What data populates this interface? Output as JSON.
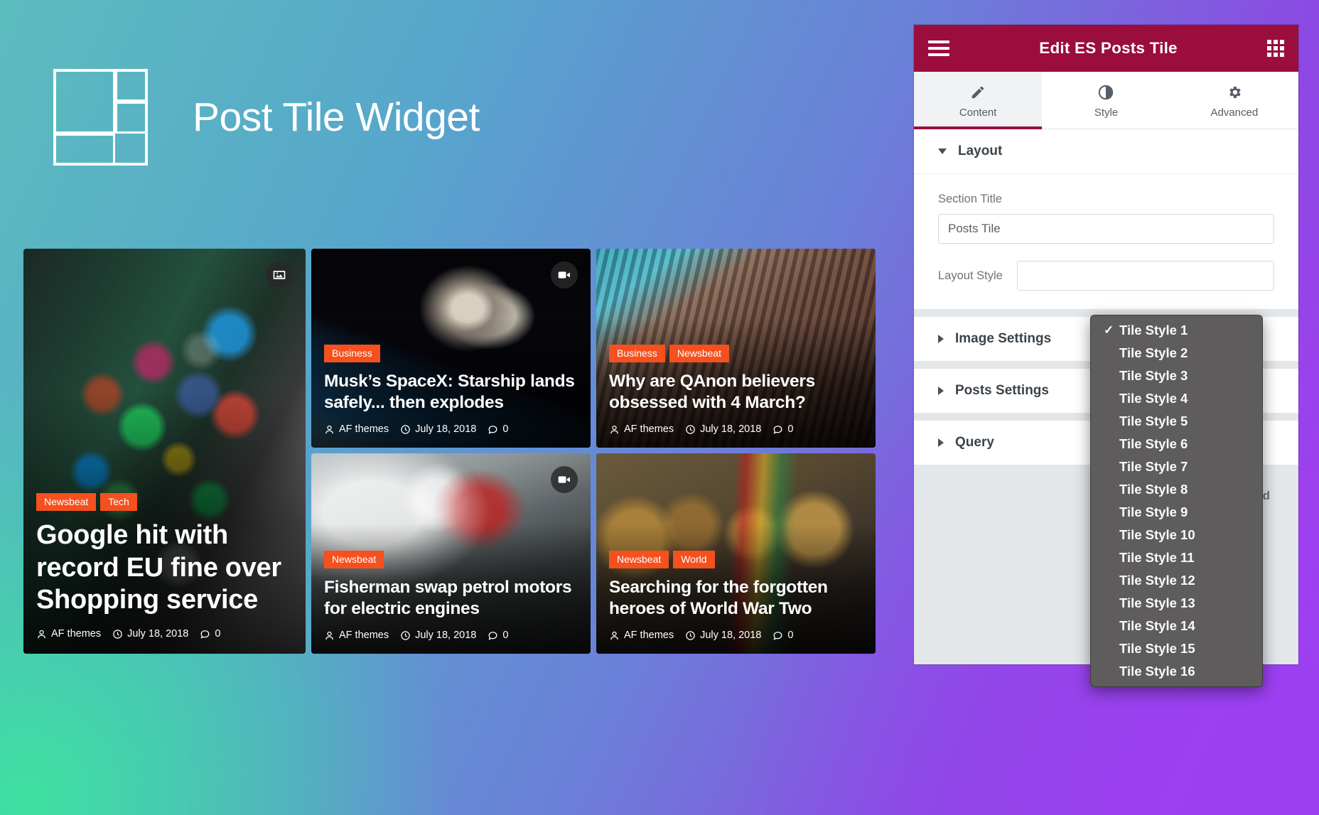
{
  "hero": {
    "title": "Post Tile Widget",
    "logo_icon": "tile-grid-logo"
  },
  "tiles": [
    {
      "categories": [
        "Newsbeat",
        "Tech"
      ],
      "title": "Google hit with record EU fine over Shopping service",
      "author": "AF themes",
      "date": "July 18, 2018",
      "comments": "0",
      "media_icon": "image-icon",
      "size": "big"
    },
    {
      "categories": [
        "Business"
      ],
      "title": "Musk’s SpaceX: Starship lands safely... then explodes",
      "author": "AF themes",
      "date": "July 18, 2018",
      "comments": "0",
      "media_icon": "video-icon",
      "size": "small"
    },
    {
      "categories": [
        "Business",
        "Newsbeat"
      ],
      "title": "Why are QAnon believers obsessed with 4 March?",
      "author": "AF themes",
      "date": "July 18, 2018",
      "comments": "0",
      "media_icon": "none",
      "size": "small"
    },
    {
      "categories": [
        "Newsbeat"
      ],
      "title": "Fisherman swap petrol motors for electric engines",
      "author": "AF themes",
      "date": "July 18, 2018",
      "comments": "0",
      "media_icon": "video-icon",
      "size": "small"
    },
    {
      "categories": [
        "Newsbeat",
        "World"
      ],
      "title": "Searching for the forgotten heroes of World War Two",
      "author": "AF themes",
      "date": "July 18, 2018",
      "comments": "0",
      "media_icon": "none",
      "size": "small"
    }
  ],
  "panel": {
    "header": {
      "title": "Edit ES Posts Tile",
      "menu_icon": "hamburger-icon",
      "apps_icon": "grid-apps-icon"
    },
    "tabs": [
      {
        "label": "Content",
        "icon": "pencil-icon",
        "active": true
      },
      {
        "label": "Style",
        "icon": "contrast-icon",
        "active": false
      },
      {
        "label": "Advanced",
        "icon": "gear-icon",
        "active": false
      }
    ],
    "sections": [
      {
        "title": "Layout",
        "expanded": true
      },
      {
        "title": "Image Settings",
        "expanded": false
      },
      {
        "title": "Posts Settings",
        "expanded": false
      },
      {
        "title": "Query",
        "expanded": false
      }
    ],
    "fields": {
      "section_title_label": "Section Title",
      "section_title_value": "Posts Tile",
      "section_title_placeholder": "Posts Tile",
      "layout_style_label": "Layout Style"
    },
    "footer": {
      "need_help": "Need"
    },
    "colors": {
      "header_bg": "#9b0d3c",
      "accent": "#9b0d3c",
      "panel_bg": "#e3e7ea"
    }
  },
  "dropdown": {
    "selected": "Tile Style 1",
    "check_glyph": "✓",
    "options": [
      "Tile Style 1",
      "Tile Style 2",
      "Tile Style 3",
      "Tile Style 4",
      "Tile Style 5",
      "Tile Style 6",
      "Tile Style 7",
      "Tile Style 8",
      "Tile Style 9",
      "Tile Style 10",
      "Tile Style 11",
      "Tile Style 12",
      "Tile Style 13",
      "Tile Style 14",
      "Tile Style 15",
      "Tile Style 16"
    ]
  },
  "theme": {
    "category_badge": "#f5501e",
    "hero_text": "#ffffff"
  }
}
